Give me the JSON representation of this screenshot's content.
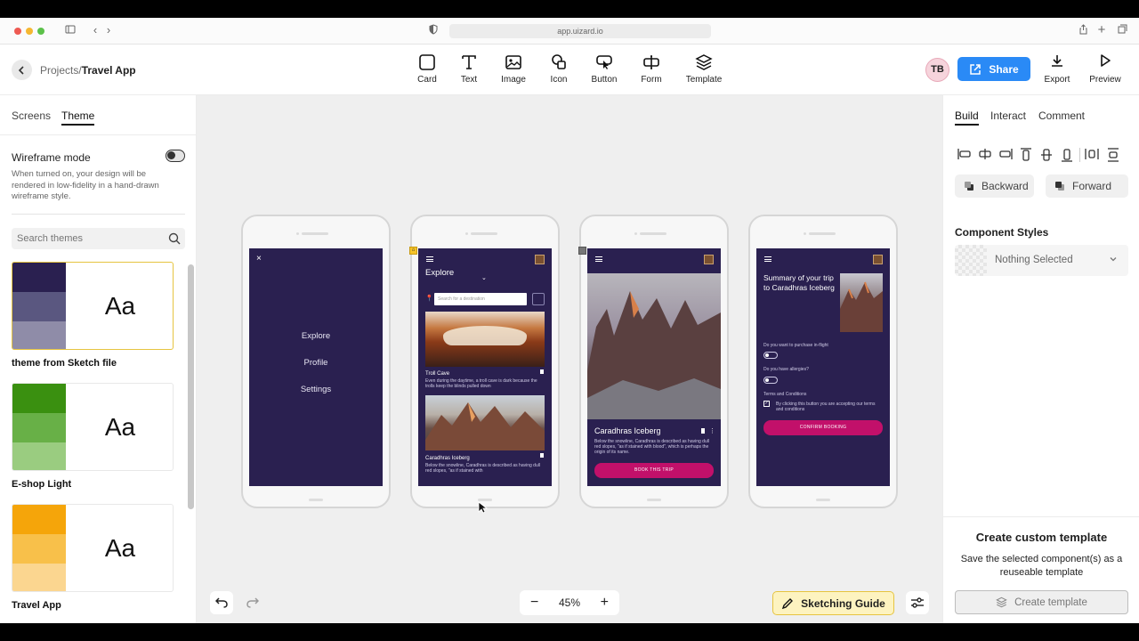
{
  "browser": {
    "url": "app.uizard.io"
  },
  "header": {
    "breadcrumb_root": "Projects",
    "breadcrumb_sep": "/",
    "breadcrumb_current": "Travel App",
    "tools": [
      {
        "label": "Card",
        "icon": "card-icon"
      },
      {
        "label": "Text",
        "icon": "text-icon"
      },
      {
        "label": "Image",
        "icon": "image-icon"
      },
      {
        "label": "Icon",
        "icon": "shapes-icon"
      },
      {
        "label": "Button",
        "icon": "button-icon"
      },
      {
        "label": "Form",
        "icon": "form-icon"
      },
      {
        "label": "Template",
        "icon": "layers-icon"
      }
    ],
    "avatar": "TB",
    "share_label": "Share",
    "export_label": "Export",
    "preview_label": "Preview"
  },
  "left_panel": {
    "tabs": [
      "Screens",
      "Theme"
    ],
    "active_tab": "Theme",
    "wireframe_title": "Wireframe mode",
    "wireframe_desc": "When turned on, your design will be rendered in low-fidelity in a hand-drawn wireframe style.",
    "search_placeholder": "Search themes",
    "themes": [
      {
        "name": "theme from Sketch file",
        "sample": "Aa",
        "colors": [
          "#2a2050",
          "#5a5780",
          "#8f8ca8"
        ]
      },
      {
        "name": "E-shop Light",
        "sample": "Aa",
        "colors": [
          "#3a9010",
          "#68b047",
          "#9acc80"
        ]
      },
      {
        "name": "Travel App",
        "sample": "Aa",
        "colors": [
          "#f5a50a",
          "#f8c04a",
          "#fbd690"
        ]
      }
    ]
  },
  "screens": {
    "menu": {
      "items": [
        "Explore",
        "Profile",
        "Settings"
      ]
    },
    "explore": {
      "title": "Explore",
      "search_placeholder": "Search for a destination",
      "card1_title": "Troll Cave",
      "card1_desc": "Even during the daytime, a troll cave is dark because the trolls keep the blinds pulled down",
      "card2_title": "Caradhras Iceberg",
      "card2_desc": "Below the snowline, Caradhras is described as having dull red slopes, \"as if stained with"
    },
    "detail": {
      "title": "Caradhras Iceberg",
      "desc": "Below the snowline, Caradhras is described as having dull red slopes, \"as if stained with blood\", which is perhaps the origin of its name.",
      "button": "BOOK THIS TRIP"
    },
    "summary": {
      "title": "Summary of your trip to Caradhras Iceberg",
      "q1": "Do you want to purchase in-flight",
      "q2": "Do you have allergies?",
      "terms_title": "Terms and Conditions",
      "terms_text": "By clicking this button you are accepting our terms and conditions",
      "button": "CONFIRM BOOKING"
    }
  },
  "canvas": {
    "zoom": "45%",
    "sketch_guide_label": "Sketching Guide"
  },
  "right_panel": {
    "tabs": [
      "Build",
      "Interact",
      "Comment"
    ],
    "active_tab": "Build",
    "backward_label": "Backward",
    "forward_label": "Forward",
    "component_styles_label": "Component Styles",
    "component_styles_value": "Nothing Selected",
    "template_title": "Create custom template",
    "template_desc": "Save the selected component(s) as a reuseable template",
    "template_button": "Create template"
  },
  "colors": {
    "accent": "#2a8af6",
    "screen_bg": "#2a2050",
    "cta": "#c2106a",
    "guide_bg": "#fdf3c0"
  }
}
